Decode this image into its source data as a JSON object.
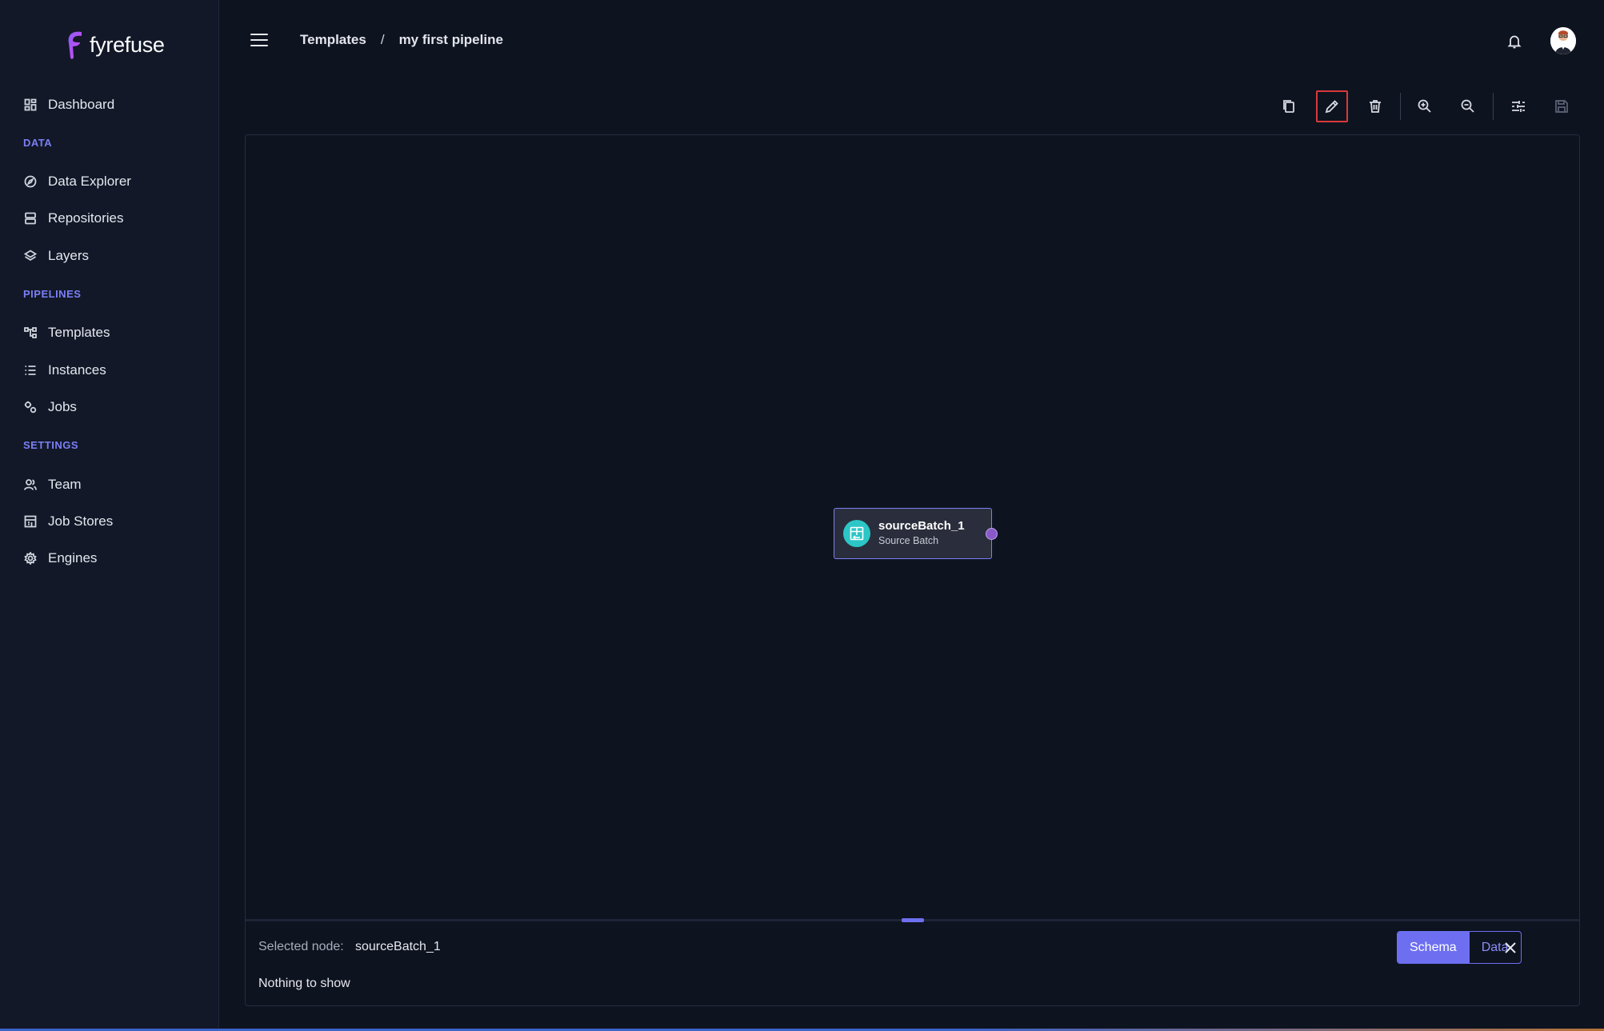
{
  "brand": {
    "name": "fyrefuse"
  },
  "sidebar": {
    "dashboard": "Dashboard",
    "sections": {
      "data": "DATA",
      "pipelines": "PIPELINES",
      "settings": "SETTINGS"
    },
    "data_items": [
      "Data Explorer",
      "Repositories",
      "Layers"
    ],
    "pipeline_items": [
      "Templates",
      "Instances",
      "Jobs"
    ],
    "settings_items": [
      "Team",
      "Job Stores",
      "Engines"
    ]
  },
  "header": {
    "breadcrumb": {
      "parent": "Templates",
      "separator": "/",
      "current": "my first pipeline"
    }
  },
  "toolbar": {
    "icons": [
      "copy-icon",
      "edit-icon",
      "delete-icon",
      "zoom-in-icon",
      "zoom-out-icon",
      "settings-sliders-icon",
      "save-icon"
    ],
    "active": "edit-icon",
    "disabled": [
      "save-icon"
    ]
  },
  "canvas": {
    "node": {
      "title": "sourceBatch_1",
      "subtitle": "Source Batch"
    }
  },
  "bottom_panel": {
    "selected_label": "Selected node:",
    "selected_value": "sourceBatch_1",
    "empty_text": "Nothing to show",
    "tabs": [
      "Schema",
      "Data"
    ],
    "active_tab": "Schema"
  },
  "colors": {
    "accent": "#6d6ff0",
    "node_icon": "#2cc6c6",
    "active_outline": "#d93a3a"
  }
}
